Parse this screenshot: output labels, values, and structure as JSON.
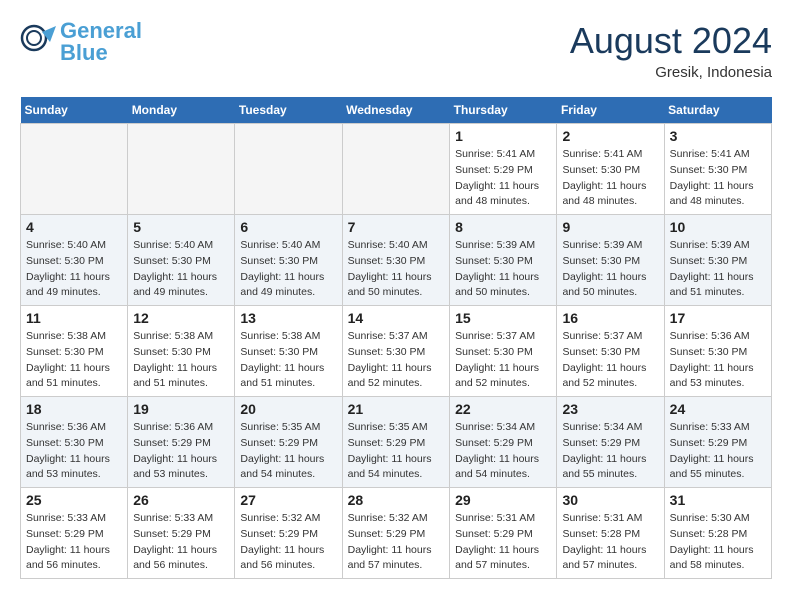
{
  "header": {
    "logo_line1": "General",
    "logo_line2": "Blue",
    "month": "August 2024",
    "location": "Gresik, Indonesia"
  },
  "days_of_week": [
    "Sunday",
    "Monday",
    "Tuesday",
    "Wednesday",
    "Thursday",
    "Friday",
    "Saturday"
  ],
  "weeks": [
    [
      {
        "day": "",
        "info": ""
      },
      {
        "day": "",
        "info": ""
      },
      {
        "day": "",
        "info": ""
      },
      {
        "day": "",
        "info": ""
      },
      {
        "day": "1",
        "info": "Sunrise: 5:41 AM\nSunset: 5:29 PM\nDaylight: 11 hours\nand 48 minutes."
      },
      {
        "day": "2",
        "info": "Sunrise: 5:41 AM\nSunset: 5:30 PM\nDaylight: 11 hours\nand 48 minutes."
      },
      {
        "day": "3",
        "info": "Sunrise: 5:41 AM\nSunset: 5:30 PM\nDaylight: 11 hours\nand 48 minutes."
      }
    ],
    [
      {
        "day": "4",
        "info": "Sunrise: 5:40 AM\nSunset: 5:30 PM\nDaylight: 11 hours\nand 49 minutes."
      },
      {
        "day": "5",
        "info": "Sunrise: 5:40 AM\nSunset: 5:30 PM\nDaylight: 11 hours\nand 49 minutes."
      },
      {
        "day": "6",
        "info": "Sunrise: 5:40 AM\nSunset: 5:30 PM\nDaylight: 11 hours\nand 49 minutes."
      },
      {
        "day": "7",
        "info": "Sunrise: 5:40 AM\nSunset: 5:30 PM\nDaylight: 11 hours\nand 50 minutes."
      },
      {
        "day": "8",
        "info": "Sunrise: 5:39 AM\nSunset: 5:30 PM\nDaylight: 11 hours\nand 50 minutes."
      },
      {
        "day": "9",
        "info": "Sunrise: 5:39 AM\nSunset: 5:30 PM\nDaylight: 11 hours\nand 50 minutes."
      },
      {
        "day": "10",
        "info": "Sunrise: 5:39 AM\nSunset: 5:30 PM\nDaylight: 11 hours\nand 51 minutes."
      }
    ],
    [
      {
        "day": "11",
        "info": "Sunrise: 5:38 AM\nSunset: 5:30 PM\nDaylight: 11 hours\nand 51 minutes."
      },
      {
        "day": "12",
        "info": "Sunrise: 5:38 AM\nSunset: 5:30 PM\nDaylight: 11 hours\nand 51 minutes."
      },
      {
        "day": "13",
        "info": "Sunrise: 5:38 AM\nSunset: 5:30 PM\nDaylight: 11 hours\nand 51 minutes."
      },
      {
        "day": "14",
        "info": "Sunrise: 5:37 AM\nSunset: 5:30 PM\nDaylight: 11 hours\nand 52 minutes."
      },
      {
        "day": "15",
        "info": "Sunrise: 5:37 AM\nSunset: 5:30 PM\nDaylight: 11 hours\nand 52 minutes."
      },
      {
        "day": "16",
        "info": "Sunrise: 5:37 AM\nSunset: 5:30 PM\nDaylight: 11 hours\nand 52 minutes."
      },
      {
        "day": "17",
        "info": "Sunrise: 5:36 AM\nSunset: 5:30 PM\nDaylight: 11 hours\nand 53 minutes."
      }
    ],
    [
      {
        "day": "18",
        "info": "Sunrise: 5:36 AM\nSunset: 5:30 PM\nDaylight: 11 hours\nand 53 minutes."
      },
      {
        "day": "19",
        "info": "Sunrise: 5:36 AM\nSunset: 5:29 PM\nDaylight: 11 hours\nand 53 minutes."
      },
      {
        "day": "20",
        "info": "Sunrise: 5:35 AM\nSunset: 5:29 PM\nDaylight: 11 hours\nand 54 minutes."
      },
      {
        "day": "21",
        "info": "Sunrise: 5:35 AM\nSunset: 5:29 PM\nDaylight: 11 hours\nand 54 minutes."
      },
      {
        "day": "22",
        "info": "Sunrise: 5:34 AM\nSunset: 5:29 PM\nDaylight: 11 hours\nand 54 minutes."
      },
      {
        "day": "23",
        "info": "Sunrise: 5:34 AM\nSunset: 5:29 PM\nDaylight: 11 hours\nand 55 minutes."
      },
      {
        "day": "24",
        "info": "Sunrise: 5:33 AM\nSunset: 5:29 PM\nDaylight: 11 hours\nand 55 minutes."
      }
    ],
    [
      {
        "day": "25",
        "info": "Sunrise: 5:33 AM\nSunset: 5:29 PM\nDaylight: 11 hours\nand 56 minutes."
      },
      {
        "day": "26",
        "info": "Sunrise: 5:33 AM\nSunset: 5:29 PM\nDaylight: 11 hours\nand 56 minutes."
      },
      {
        "day": "27",
        "info": "Sunrise: 5:32 AM\nSunset: 5:29 PM\nDaylight: 11 hours\nand 56 minutes."
      },
      {
        "day": "28",
        "info": "Sunrise: 5:32 AM\nSunset: 5:29 PM\nDaylight: 11 hours\nand 57 minutes."
      },
      {
        "day": "29",
        "info": "Sunrise: 5:31 AM\nSunset: 5:29 PM\nDaylight: 11 hours\nand 57 minutes."
      },
      {
        "day": "30",
        "info": "Sunrise: 5:31 AM\nSunset: 5:28 PM\nDaylight: 11 hours\nand 57 minutes."
      },
      {
        "day": "31",
        "info": "Sunrise: 5:30 AM\nSunset: 5:28 PM\nDaylight: 11 hours\nand 58 minutes."
      }
    ]
  ]
}
